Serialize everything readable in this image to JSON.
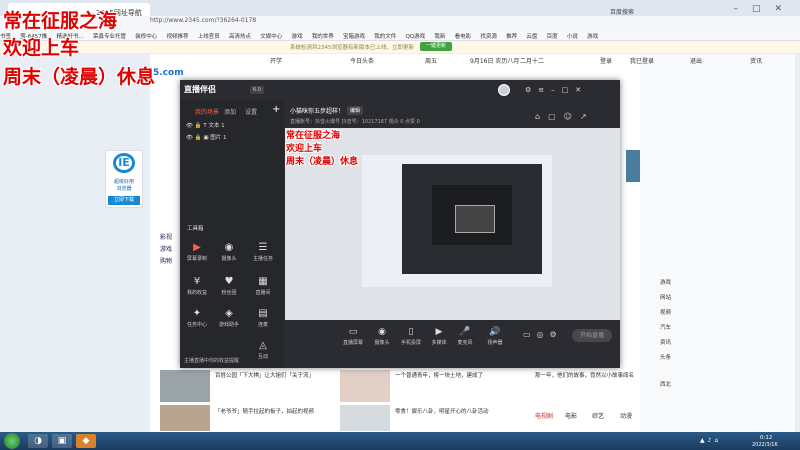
{
  "browser": {
    "tab_title": "2345网址导航",
    "url": "http://www.2345.com/?36264-0178",
    "search_engine": "百度搜索",
    "favorites": [
      "书签",
      "萤-6457推",
      "精选好书...",
      "荣鑫专业托管",
      "装修中心",
      "视频推荐",
      "上线官员",
      "高清热点",
      "文娱中心",
      "游戏",
      "我的世界",
      "宝箱游戏",
      "我的文件",
      "QQ游戏",
      "我新",
      "看电影",
      "找资源",
      "推荐",
      "云盘",
      "百度",
      "小说",
      "游戏"
    ],
    "notice_text": "系统检测到2345浏览器有新版本已上线，立即更新",
    "notice_button": "一键更新"
  },
  "overlay": {
    "line1": "常在征服之海",
    "line2": "欢迎上车",
    "line3": "周末（凌晨）休息"
  },
  "webpage": {
    "site_logo": "5.com",
    "top_items": [
      "开学",
      "今日头条",
      "周五",
      "9月16日 农历八月",
      "二月十二",
      "登录",
      "我已登录",
      "退出",
      "资讯"
    ],
    "ie_card": {
      "title": "IE",
      "line1": "超级好用",
      "line2": "浏览器",
      "button": "立即下载"
    },
    "left_nav": [
      "影视",
      "游戏",
      "购物"
    ],
    "news": [
      "百姓公园「下大棋」让大姐们「关于流」",
      "一个普通青年，将一块土地，建成了",
      "「老爷爷」随手拉起的板子，拍起的视频",
      "零食！娱乐八卦，明星开心的八卦活动",
      "那一年，他们的故事，竟然以小故事闻名"
    ],
    "right_items": [
      "游戏",
      "网站",
      "视频",
      "汽车",
      "资讯",
      "头条",
      "西北"
    ],
    "bottom_tabs": [
      "电视剧",
      "电影",
      "综艺",
      "动漫"
    ]
  },
  "live_app": {
    "name": "直播伴侣",
    "version": "6.0",
    "tabs": [
      "我的场景",
      "添加",
      "设置"
    ],
    "add_label": "+",
    "sources": [
      "文本 1",
      "图片 1"
    ],
    "tools_title": "工具箱",
    "tools": [
      "屏幕录制",
      "摄像头",
      "主播任务",
      "我的收益",
      "粉丝团",
      "直播间",
      "任务中心",
      "游戏助手",
      "连麦",
      "互动"
    ],
    "room_title": "小猫咪你五步超样！",
    "room_edit": "编辑",
    "room_info": "直播账号：抖音火爆号    抖音号：10217187    观众 0    点赞 0",
    "bottom_buttons": [
      "直播屏幕",
      "摄像头",
      "手机投屏",
      "多媒体",
      "麦克风",
      "扬声器"
    ],
    "go_live": "开始直播",
    "footer_notice": "主播直播中你的收益提醒"
  },
  "taskbar": {
    "time": "0:12",
    "date": "2022/3/16"
  }
}
